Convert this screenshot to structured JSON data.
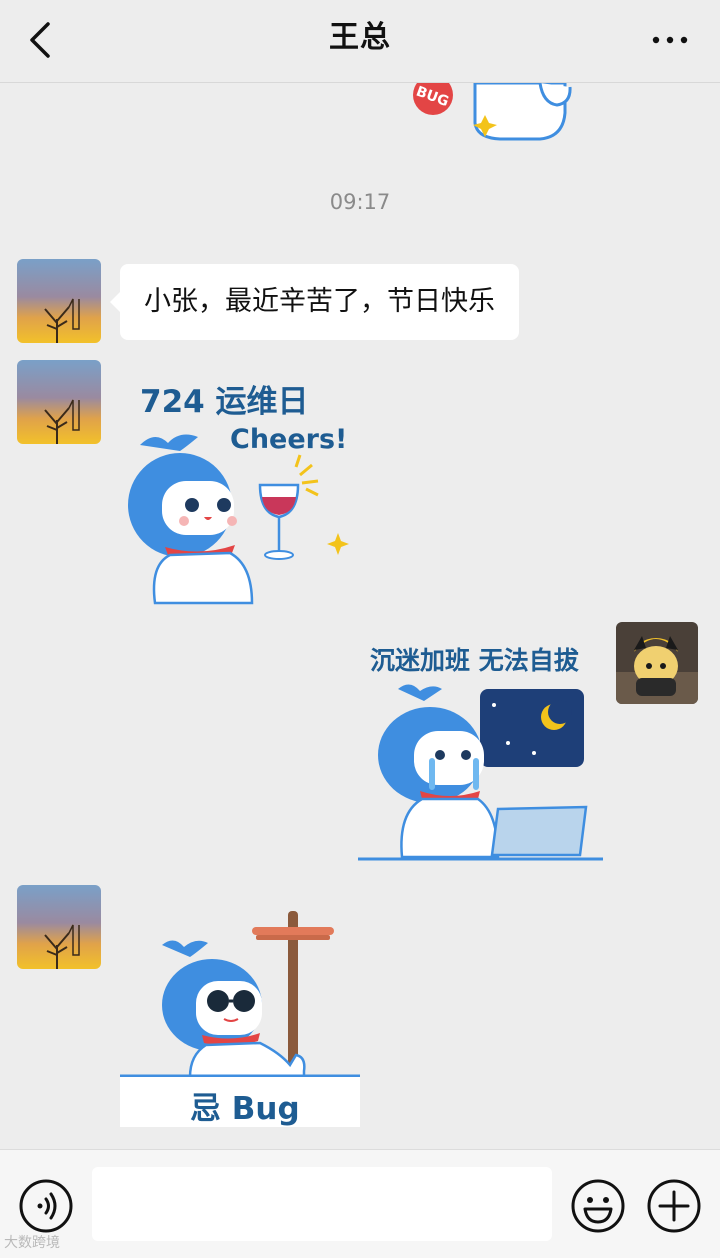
{
  "header": {
    "title": "王总"
  },
  "messages": {
    "timestamp": "09:17",
    "text_message": "小张，最近辛苦了，节日快乐",
    "sticker_top_partial": {
      "badge": "BUG"
    },
    "sticker_cheers": {
      "line1": "724 运维日",
      "line2": "Cheers!"
    },
    "sticker_overtime": {
      "caption": "沉迷加班 无法自拔"
    },
    "sticker_bug": {
      "caption": "忌 Bug"
    }
  },
  "input": {
    "value": "",
    "placeholder": ""
  },
  "icons": [
    "back-icon",
    "more-icon",
    "voice-icon",
    "emoji-icon",
    "plus-icon"
  ],
  "watermark": "大数跨境",
  "colors": {
    "background": "#ededed",
    "bubble": "#ffffff",
    "sticker_blue": "#3f8ee0",
    "sticker_text": "#1e5c92"
  }
}
